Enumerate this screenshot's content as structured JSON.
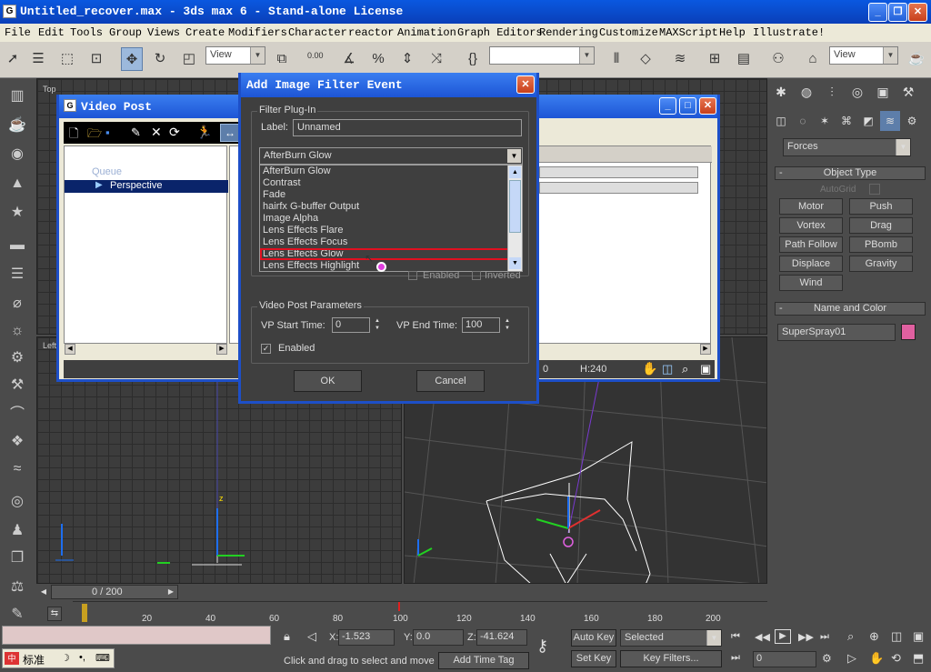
{
  "window": {
    "title": "Untitled_recover.max - 3ds max 6 - Stand-alone License",
    "min_label": "_",
    "max_label": "❐",
    "close_label": "✕"
  },
  "menu": [
    "File",
    "Edit",
    "Tools",
    "Group",
    "Views",
    "Create",
    "Modifiers",
    "Character",
    "reactor",
    "Animation",
    "Graph Editors",
    "Rendering",
    "Customize",
    "MAXScript",
    "Help",
    "Illustrate!"
  ],
  "toolbar": {
    "view_dropdown": "View",
    "snap_value": "0.00",
    "view_dropdown2": "View"
  },
  "viewports": {
    "top_label": "Top",
    "left_label": "Left"
  },
  "command_panel": {
    "category": "Forces",
    "object_type_header": "Object Type",
    "autogrid": "AutoGrid",
    "buttons": [
      "Motor",
      "Push",
      "Vortex",
      "Drag",
      "Path Follow",
      "PBomb",
      "Displace",
      "Gravity",
      "Wind"
    ],
    "name_color_header": "Name and Color",
    "object_name": "SuperSpray01",
    "object_color": "#e060a0"
  },
  "video_post": {
    "title": "Video Post",
    "queue_label": "Queue",
    "perspective_item": "Perspective",
    "h_value": "H:240",
    "s_value": "0"
  },
  "dialog": {
    "title": "Add Image Filter Event",
    "filter_group": "Filter Plug-In",
    "label_text": "Label:",
    "label_value": "Unnamed",
    "selected_plugin": "AfterBurn Glow",
    "plugins": [
      "AfterBurn Glow",
      "Contrast",
      "Fade",
      "hairfx G-buffer Output",
      "Image Alpha",
      "Lens Effects Flare",
      "Lens Effects Focus",
      "Lens Effects Glow",
      "Lens Effects Highlight"
    ],
    "highlighted_plugin": "Lens Effects Glow",
    "enabled_label": "Enabled",
    "inverted_label": "Inverted",
    "params_group": "Video Post Parameters",
    "vp_start_label": "VP Start Time:",
    "vp_start_value": "0",
    "vp_end_label": "VP End Time:",
    "vp_end_value": "100",
    "enabled_check": "Enabled",
    "ok": "OK",
    "cancel": "Cancel"
  },
  "timeline": {
    "frame_display": "0 / 200",
    "ticks": [
      "20",
      "40",
      "60",
      "80",
      "100",
      "120",
      "140",
      "160",
      "180",
      "200"
    ]
  },
  "status": {
    "x_label": "X:",
    "x_value": "-1.523",
    "y_label": "Y:",
    "y_value": "0.0",
    "z_label": "Z:",
    "z_value": "-41.624",
    "auto_key": "Auto Key",
    "selected": "Selected",
    "set_key": "Set Key",
    "key_filters": "Key Filters...",
    "frame_field": "0",
    "prompt": "Click and drag to select and move",
    "add_time_tag": "Add Time Tag",
    "ime_label": "标准"
  }
}
